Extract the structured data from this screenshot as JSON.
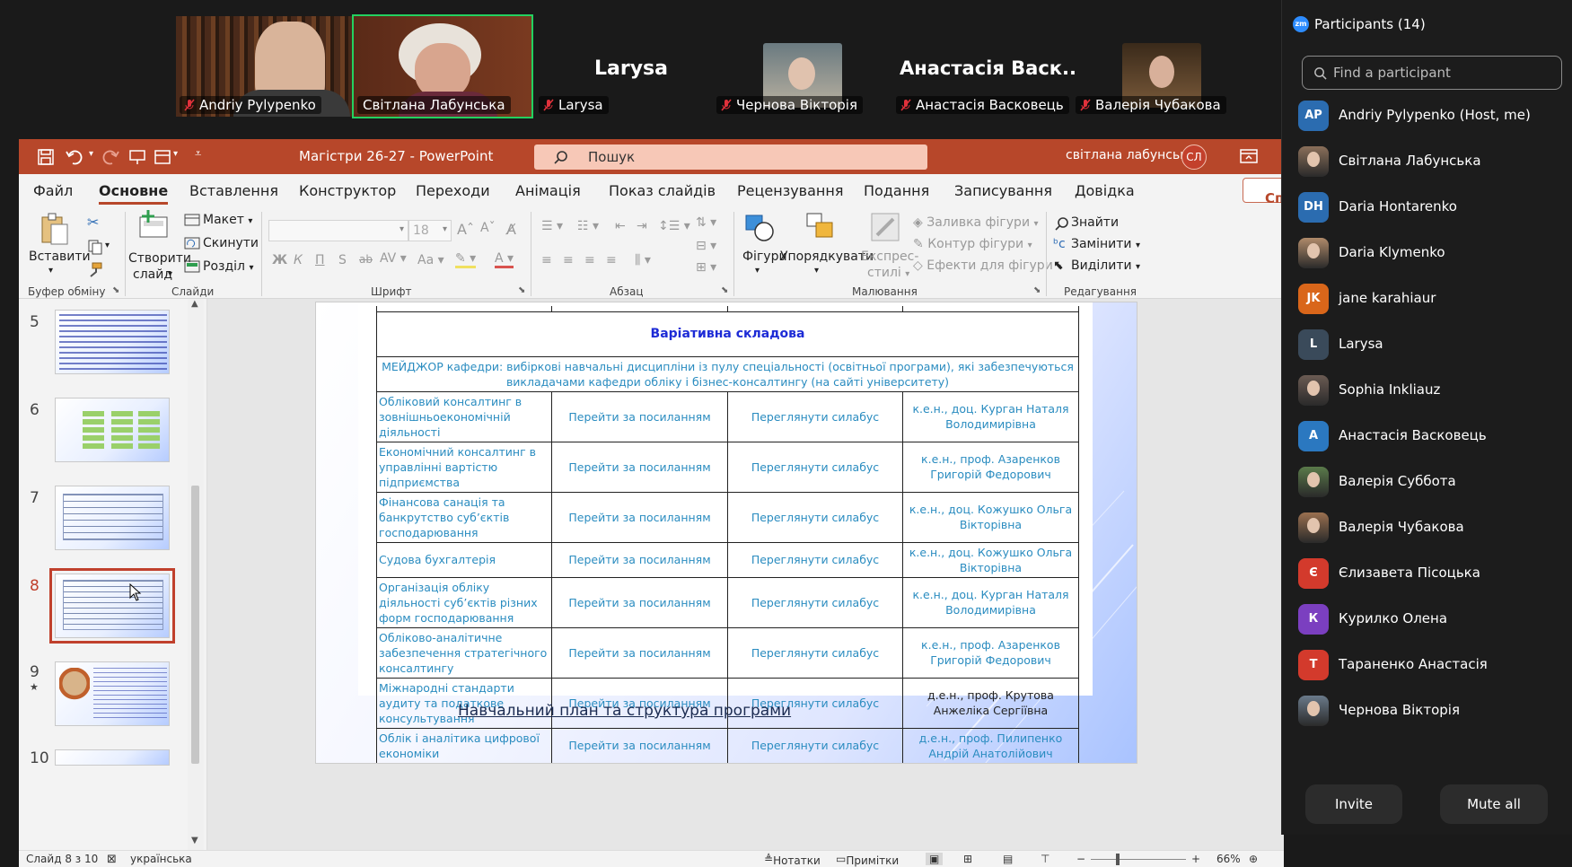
{
  "video": {
    "tiles": [
      {
        "name": "Andriy Pylypenko",
        "selected": false
      },
      {
        "name": "Світлана Лабунська",
        "selected": true
      },
      {
        "name": "Larysa",
        "big_label": "Larysa"
      },
      {
        "name": "Чернова Вікторія"
      },
      {
        "name": "Анастасія Васковець",
        "big_label": "Анастасія Васк..."
      },
      {
        "name": "Валерія Чубакова"
      }
    ]
  },
  "ppt": {
    "doc_title": "Магістри 26-27  -  PowerPoint",
    "search_placeholder": "Пошук",
    "user_name": "світлана лабунська",
    "user_initials": "СЛ",
    "menu": [
      "Файл",
      "Основне",
      "Вставлення",
      "Конструктор",
      "Переходи",
      "Анімація",
      "Показ слайдів",
      "Рецензування",
      "Подання",
      "Записування",
      "Довідка"
    ],
    "menu_active": "Основне",
    "share_label": "Сп",
    "ribbon": {
      "clipboard": {
        "paste": "Вставити",
        "label": "Буфер обміну"
      },
      "slides": {
        "new_slide_1": "Створити",
        "new_slide_2": "слайд",
        "layout": "Макет",
        "reset": "Скинути",
        "section": "Розділ",
        "label": "Слайди"
      },
      "font": {
        "size": "18",
        "bold": "Ж",
        "italic": "К",
        "underline": "П",
        "shadow": "S",
        "strike": "ab",
        "label": "Шрифт"
      },
      "paragraph": {
        "label": "Абзац"
      },
      "drawing": {
        "shapes": "Фігури",
        "arrange": "Упорядкувати",
        "quick_styles_1": "Експрес-",
        "quick_styles_2": "стилі",
        "fill": "Заливка фігури",
        "outline": "Контур фігури",
        "effects": "Ефекти для фігури",
        "label": "Малювання"
      },
      "editing": {
        "find": "Знайти",
        "replace": "Замінити",
        "select": "Виділити",
        "label": "Редагування"
      }
    },
    "thumbnails": [
      {
        "num": "5"
      },
      {
        "num": "6"
      },
      {
        "num": "7"
      },
      {
        "num": "8",
        "selected": true
      },
      {
        "num": "9",
        "star": "★"
      },
      {
        "num": "10"
      }
    ],
    "slide": {
      "section_title": "Варіативна складова",
      "section_subtitle": "МЕЙДЖОР кафедри: вибіркові навчальні дисципліни із пулу спеціальності (освітньої програми), які забезпечуються викладачами кафедри обліку і бізнес-консалтингу (на сайті університету)",
      "rows": [
        {
          "course": "Обліковий консалтинг в зовнішньоекономічній діяльності",
          "link": "Перейти за посиланням",
          "syllabus": "Переглянути силабус",
          "teacher": "к.е.н., доц. Курган Наталя Володимирівна"
        },
        {
          "course": "Економічний консалтинг в управлінні вартістю підприємства",
          "link": "Перейти за посиланням",
          "syllabus": "Переглянути силабус",
          "teacher": "к.е.н., проф. Азаренков Григорій Федорович"
        },
        {
          "course": "Фінансова санація та банкрутство суб’єктів господарювання",
          "link": "Перейти за посиланням",
          "syllabus": "Переглянути силабус",
          "teacher": "к.е.н., доц. Кожушко Ольга Вікторівна"
        },
        {
          "course": "Судова бухгалтерія",
          "link": "Перейти за посиланням",
          "syllabus": "Переглянути силабус",
          "teacher": "к.е.н., доц. Кожушко Ольга Вікторівна"
        },
        {
          "course": "Організація обліку діяльності суб’єктів різних форм господарювання",
          "link": "Перейти за посиланням",
          "syllabus": "Переглянути силабус",
          "teacher": "к.е.н., доц. Курган Наталя Володимирівна"
        },
        {
          "course": "Обліково-аналітичне забезпечення стратегічного консалтингу",
          "link": "Перейти за посиланням",
          "syllabus": "Переглянути силабус",
          "teacher": "к.е.н., проф. Азаренков Григорій Федорович"
        },
        {
          "course": "Міжнародні стандарти аудиту та податкове консультування",
          "link": "Перейти за посиланням",
          "syllabus": "Переглянути силабус",
          "teacher": "д.е.н., проф. Крутова Анжеліка Сергіївна",
          "teacher_dark": true
        },
        {
          "course": "Облік і аналітика цифрової економіки",
          "link": "Перейти за посиланням",
          "syllabus": "Переглянути силабус",
          "teacher": "д.е.н., проф. Пилипенко Андрій Анатолійович"
        }
      ],
      "bottom_link": "Навчальний план та структура програми"
    },
    "status": {
      "slide_info": "Слайд 8 з 10",
      "language": "українська",
      "notes": "Нотатки",
      "comments": "Примітки",
      "zoom": "66%"
    }
  },
  "participants": {
    "title": "Participants (14)",
    "search_placeholder": "Find a participant",
    "list": [
      {
        "initials": "AP",
        "name": "Andriy Pylypenko (Host, me)",
        "color": "#2b6cb0"
      },
      {
        "initials": "",
        "name": "Світлана Лабунська",
        "color": "#8a6f5a",
        "photo": true
      },
      {
        "initials": "DH",
        "name": "Daria Hontarenko",
        "color": "#2b6cb0"
      },
      {
        "initials": "",
        "name": "Daria Klymenko",
        "color": "#b08a6a",
        "photo": true
      },
      {
        "initials": "JK",
        "name": "jane karahiaur",
        "color": "#d9661a"
      },
      {
        "initials": "L",
        "name": "Larysa",
        "color": "#3a4a5a"
      },
      {
        "initials": "",
        "name": "Sophia Inkliauz",
        "color": "#6b5b53",
        "photo": true
      },
      {
        "initials": "A",
        "name": "Анастасія Васковець",
        "color": "#2b78c0"
      },
      {
        "initials": "",
        "name": "Валерія Суббота",
        "color": "#5a7a4a",
        "photo": true
      },
      {
        "initials": "",
        "name": "Валерія Чубакова",
        "color": "#9a7050",
        "photo": true
      },
      {
        "initials": "Є",
        "name": "Єлизавета Пісоцька",
        "color": "#d33a2c"
      },
      {
        "initials": "К",
        "name": "Курилко Олена",
        "color": "#7b3fc0"
      },
      {
        "initials": "Т",
        "name": "Тараненко Анастасія",
        "color": "#d33a2c"
      },
      {
        "initials": "",
        "name": "Чернова Вікторія",
        "color": "#6a7a8a",
        "photo": true
      }
    ],
    "invite": "Invite",
    "mute_all": "Mute all"
  },
  "colors": {
    "ppt_accent": "#b7472a",
    "zoom_selected": "#23d160",
    "link_blue": "#2a8cc0"
  }
}
